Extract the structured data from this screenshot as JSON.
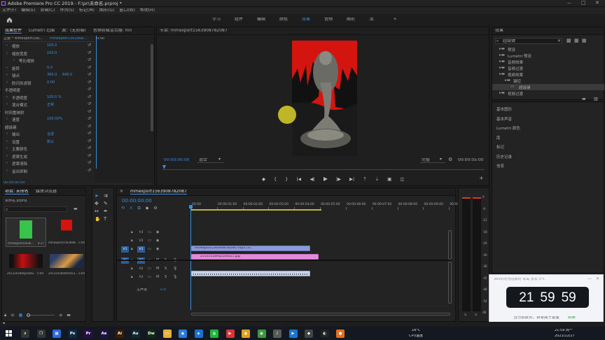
{
  "window": {
    "title": "Adobe Premiere Pro CC 2019 - F:\\pr\\未命名.prproj *",
    "minimize": "—",
    "maximize": "□",
    "close": "✕"
  },
  "menu": [
    "文件(F)",
    "编辑(E)",
    "剪辑(C)",
    "序列(S)",
    "标记(M)",
    "图形(G)",
    "窗口(W)",
    "帮助(H)"
  ],
  "workspaces": {
    "items": [
      "学习",
      "组件",
      "编辑",
      "颜色",
      "效果",
      "音频",
      "图形",
      "库"
    ],
    "active": "效果",
    "more": "»"
  },
  "effect_controls": {
    "tabs": [
      "效果控件",
      "Lumetri 范围",
      "源：(无剪辑)",
      "音频剪辑混合器: mn"
    ],
    "clip_master": "主要 * mmexport156...",
    "clip_seq": "mmexport1563908...",
    "timecode_start": "0:00",
    "timecode": "00:00:00:00",
    "rows": [
      {
        "label": "缩放",
        "value": "100.0"
      },
      {
        "label": "缩放宽度",
        "value": "100.0"
      },
      {
        "label": "等比缩放",
        "value": ""
      },
      {
        "label": "旋转",
        "value": "0.0"
      },
      {
        "label": "锚点",
        "value": "360.0",
        "value2": "640.0"
      },
      {
        "label": "防闪烁滤镜",
        "value": "0.00"
      },
      {
        "label": "不透明度",
        "value": ""
      },
      {
        "label": "不透明度",
        "value": "100.0 %"
      },
      {
        "label": "混合模式",
        "value": "正常"
      },
      {
        "label": "时间重映射",
        "value": ""
      },
      {
        "label": "速度",
        "value": "100.00%"
      },
      {
        "label": "超级键",
        "value": ""
      },
      {
        "label": "输出",
        "value": "合成"
      },
      {
        "label": "设置",
        "value": "默认"
      },
      {
        "label": "主要颜色",
        "value": ""
      },
      {
        "label": "遮罩生成",
        "value": ""
      },
      {
        "label": "遮罩清除",
        "value": ""
      },
      {
        "label": "溢出抑制",
        "value": ""
      }
    ]
  },
  "program": {
    "title": "节目: mmexport1563908782087",
    "timecode_left": "00:00:00:00",
    "fit": "适合",
    "quality": "完整",
    "timecode_right": "00:00:05:00"
  },
  "effects_panel": {
    "title": "效果",
    "search_value": "超级键",
    "tree": [
      "预设",
      "Lumetri 预设",
      "音频效果",
      "音频过渡",
      "视频效果",
      "键控",
      "超级键",
      "视频过渡"
    ],
    "sections": [
      "基本图形",
      "基本声音",
      "Lumetri 颜色",
      "库",
      "标记",
      "历史记录",
      "信息"
    ]
  },
  "project": {
    "tabs": [
      "项目: 未命名",
      "媒体浏览器"
    ],
    "file": "未命名.prproj",
    "items": [
      {
        "name": "mmexport15636...",
        "dur": "4:17"
      },
      {
        "name": "mmexport1563908...",
        "dur": "5:00"
      },
      {
        "name": "20131018ekjsaidoi...",
        "dur": "5:00"
      },
      {
        "name": "20131018ekfree53...",
        "dur": "5:00"
      }
    ]
  },
  "timeline": {
    "tab": "mmexport1563908782087",
    "timecode": "00:00:00:00",
    "ruler": [
      "00:00",
      "00:00:01:00",
      "00:00:02:00",
      "00:00:03:00",
      "00:00:04:00",
      "00:00:05:00",
      "00:00:06:00",
      "00:00:07:00",
      "00:00:08:00",
      "00:00:09:00",
      "00:00:10:00"
    ],
    "tracks": [
      "V3",
      "V2",
      "V1",
      "A1",
      "A2",
      "A3"
    ],
    "master": "主声道",
    "master_value": "0.0",
    "clip_v2": "mmexport1563908782087.mp4 [V]",
    "clip_v1": "20131018ekjsaidoi21.jpg",
    "colors": {
      "v_clip": "#8a9bd4",
      "pink_clip": "#e48ad9",
      "audio_clip": "#c9d3e6",
      "accent": "#3d8ee0"
    }
  },
  "meter": {
    "ticks": [
      "0",
      "-6",
      "-12",
      "-18",
      "-24",
      "-30",
      "-36",
      "-42",
      "-48",
      "-54",
      "dB"
    ],
    "labels": [
      "S",
      "S"
    ]
  },
  "clock_widget": {
    "title": "360日历为您报时 青岛 多云 3°C",
    "hour": "21",
    "minute": "59",
    "second": "59",
    "bottom": "当马云数去，自有属于繁星",
    "link": "刷新"
  },
  "taskbar": {
    "weather_temp": "18°C",
    "weather_label": "CPU温度",
    "time": "21:59 周一",
    "date": "2021/12/27"
  }
}
